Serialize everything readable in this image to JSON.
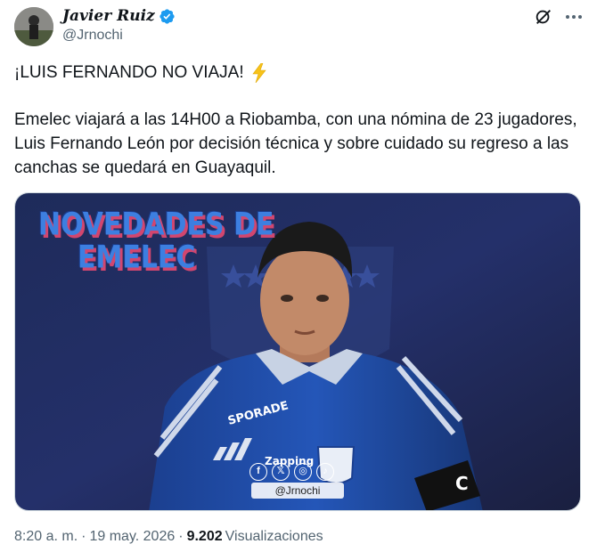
{
  "author": {
    "name": "Javier Ruiz",
    "handle": "@Jrnochi",
    "verified_color": "#1d9bf0"
  },
  "tweet": {
    "headline": "¡LUIS FERNANDO NO VIAJA!",
    "headline_emoji": "high-voltage",
    "body": "Emelec viajará a las 14H00 a Riobamba, con una nómina de 23 jugadores, Luis Fernando León por decisión técnica y sobre cuidado su regreso a las canchas se quedará en Guayaquil."
  },
  "media": {
    "overlay_line1": "NOVEDADES DE",
    "overlay_line2": "EMELEC",
    "jersey_brand": "SPORADE",
    "jersey_sponsor": "Zapping",
    "watermark_handle": "@Jrnochi",
    "social_icons": [
      "f",
      "𝕏",
      "◎",
      "♪"
    ]
  },
  "footer": {
    "time": "8:20 a. m.",
    "separator": "·",
    "date": "19 may. 2026",
    "views_count": "9.202",
    "views_label": "Visualizaciones"
  },
  "icons": {
    "grok": "grok-icon",
    "more": "more-icon"
  }
}
